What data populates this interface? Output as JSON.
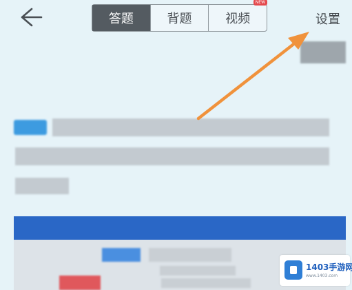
{
  "header": {
    "back_icon": "back-arrow-icon",
    "tabs": [
      {
        "label": "答题",
        "active": true
      },
      {
        "label": "背题",
        "active": false
      },
      {
        "label": "视频",
        "active": false,
        "badge": "NEW"
      }
    ],
    "settings_label": "设置"
  },
  "colors": {
    "background": "#e6f3f8",
    "active_tab": "#545b61",
    "arrow": "#f0923c",
    "panel_header": "#2a67c6",
    "badge": "#e4484c"
  },
  "watermark": {
    "text": "1403手游网",
    "sub": "www.1403.com"
  }
}
